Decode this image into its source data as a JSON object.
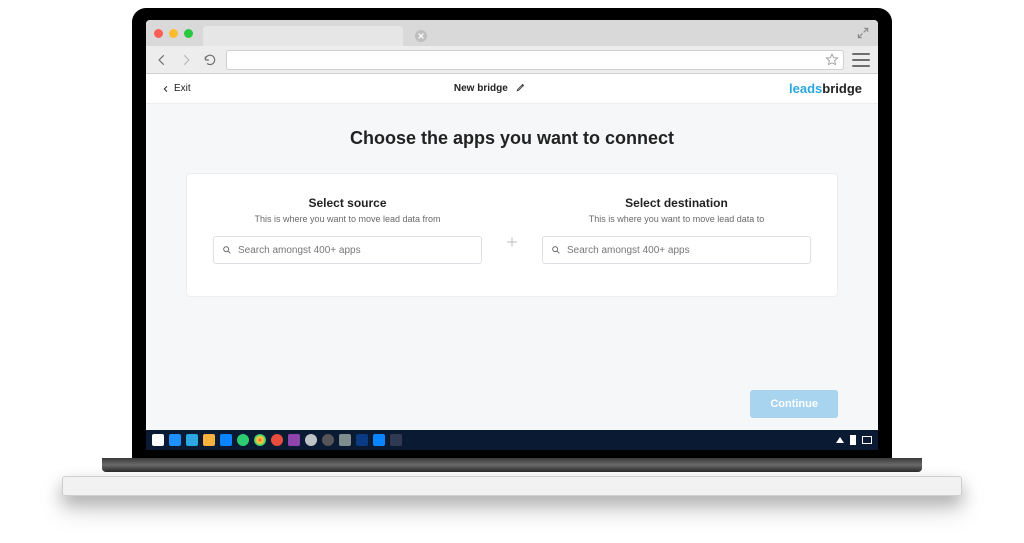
{
  "header": {
    "exit_label": "Exit",
    "bridge_name": "New bridge",
    "logo_leads": "leads",
    "logo_bridge": "bridge"
  },
  "main": {
    "title": "Choose the apps you want to connect",
    "source": {
      "title": "Select source",
      "subtitle": "This is where you want to move lead data from",
      "placeholder": "Search amongst 400+ apps"
    },
    "destination": {
      "title": "Select destination",
      "subtitle": "This is where you want to move lead data to",
      "placeholder": "Search amongst 400+ apps"
    },
    "continue_label": "Continue"
  }
}
